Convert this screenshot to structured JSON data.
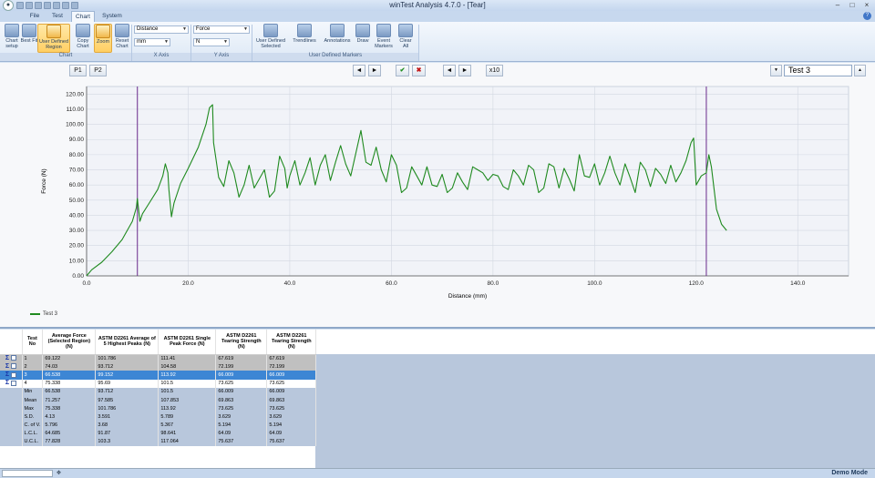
{
  "app": {
    "title": "winTest Analysis 4.7.0 - [Tear]",
    "icon": "app-logo-icon",
    "window_buttons": [
      "–",
      "□",
      "×"
    ]
  },
  "tabs": [
    {
      "label": "File"
    },
    {
      "label": "Test"
    },
    {
      "label": "Chart"
    },
    {
      "label": "System"
    }
  ],
  "active_tab": "Chart",
  "ribbon": {
    "chart_group": {
      "label": "Chart",
      "buttons": [
        "Chart setup",
        "Best Fit",
        "User Defined Region",
        "Copy Chart",
        "Zoom",
        "Reset Chart"
      ]
    },
    "x_axis": {
      "label": "X Axis",
      "quantity": "Distance",
      "unit": "mm"
    },
    "y_axis": {
      "label": "Y Axis",
      "quantity": "Force",
      "unit": "N"
    },
    "markers_group": {
      "label": "User Defined Markers",
      "buttons": [
        "User Defined Selected",
        "Trendlines",
        "Annotations",
        "Draw",
        "Event Markers",
        "Clear All"
      ]
    }
  },
  "toolbar": {
    "p1": "P1",
    "p2": "P2",
    "prev": "◄",
    "next": "►",
    "accept": "✔",
    "reject": "✖",
    "prev2": "◄",
    "next2": "►",
    "x10": "x10",
    "test_select": "Test 3",
    "down": "▼",
    "up": "▲"
  },
  "chart_data": {
    "type": "line",
    "xlabel": "Distance (mm)",
    "ylabel": "Force (N)",
    "xlim": [
      0,
      150
    ],
    "ylim": [
      0,
      125
    ],
    "x_ticks": [
      "0.0",
      "20.0",
      "40.0",
      "60.0",
      "80.0",
      "100.0",
      "120.0",
      "140.0"
    ],
    "y_ticks": [
      "0.00",
      "10.00",
      "20.00",
      "30.00",
      "40.00",
      "50.00",
      "60.00",
      "70.00",
      "80.00",
      "90.00",
      "100.00",
      "110.00",
      "120.00"
    ],
    "region_markers": [
      10,
      122
    ],
    "grid": true,
    "legend": "bottom-left",
    "series": [
      {
        "name": "Test 3",
        "color": "#1f8a1f",
        "points": [
          [
            0,
            0
          ],
          [
            1,
            4
          ],
          [
            3,
            9
          ],
          [
            5,
            16
          ],
          [
            7,
            24
          ],
          [
            8,
            30
          ],
          [
            9,
            36
          ],
          [
            9.8,
            45
          ],
          [
            10,
            51
          ],
          [
            10.5,
            36
          ],
          [
            11,
            41
          ],
          [
            12.5,
            49
          ],
          [
            14,
            57
          ],
          [
            15,
            66
          ],
          [
            15.5,
            74
          ],
          [
            16,
            68
          ],
          [
            16.2,
            57
          ],
          [
            16.7,
            39
          ],
          [
            17.2,
            48
          ],
          [
            18.5,
            61
          ],
          [
            20,
            71
          ],
          [
            22,
            85
          ],
          [
            23.5,
            100
          ],
          [
            24.2,
            111
          ],
          [
            24.8,
            113
          ],
          [
            25,
            88
          ],
          [
            26,
            65
          ],
          [
            27,
            59
          ],
          [
            28,
            76
          ],
          [
            29,
            68
          ],
          [
            30,
            52
          ],
          [
            31,
            60
          ],
          [
            32,
            73
          ],
          [
            33,
            58
          ],
          [
            34,
            64
          ],
          [
            35,
            70
          ],
          [
            36,
            52
          ],
          [
            37,
            56
          ],
          [
            38,
            79
          ],
          [
            39,
            71
          ],
          [
            39.5,
            58
          ],
          [
            40,
            66
          ],
          [
            41,
            76
          ],
          [
            42,
            60
          ],
          [
            43,
            68
          ],
          [
            44,
            78
          ],
          [
            45,
            60
          ],
          [
            46,
            73
          ],
          [
            47,
            80
          ],
          [
            48,
            63
          ],
          [
            49,
            75
          ],
          [
            50,
            86
          ],
          [
            51,
            74
          ],
          [
            52,
            66
          ],
          [
            53,
            81
          ],
          [
            54,
            96
          ],
          [
            55,
            75
          ],
          [
            56,
            73
          ],
          [
            57,
            85
          ],
          [
            58,
            70
          ],
          [
            59,
            62
          ],
          [
            60,
            80
          ],
          [
            61,
            73
          ],
          [
            62,
            55
          ],
          [
            63,
            58
          ],
          [
            64,
            72
          ],
          [
            65,
            66
          ],
          [
            66,
            60
          ],
          [
            67,
            72
          ],
          [
            68,
            60
          ],
          [
            69,
            59
          ],
          [
            70,
            67
          ],
          [
            71,
            55
          ],
          [
            72,
            58
          ],
          [
            73,
            68
          ],
          [
            74,
            62
          ],
          [
            75,
            57
          ],
          [
            76,
            72
          ],
          [
            77,
            70
          ],
          [
            78,
            68
          ],
          [
            79,
            63
          ],
          [
            80,
            67
          ],
          [
            81,
            66
          ],
          [
            82,
            59
          ],
          [
            83,
            57
          ],
          [
            84,
            70
          ],
          [
            85,
            66
          ],
          [
            86,
            60
          ],
          [
            87,
            73
          ],
          [
            88,
            70
          ],
          [
            89,
            55
          ],
          [
            90,
            58
          ],
          [
            91,
            74
          ],
          [
            92,
            72
          ],
          [
            93,
            58
          ],
          [
            94,
            71
          ],
          [
            95,
            64
          ],
          [
            96,
            56
          ],
          [
            97,
            80
          ],
          [
            98,
            66
          ],
          [
            99,
            65
          ],
          [
            100,
            74
          ],
          [
            101,
            60
          ],
          [
            102,
            68
          ],
          [
            103,
            79
          ],
          [
            104,
            68
          ],
          [
            105,
            60
          ],
          [
            106,
            74
          ],
          [
            107,
            65
          ],
          [
            108,
            55
          ],
          [
            109,
            75
          ],
          [
            110,
            70
          ],
          [
            111,
            59
          ],
          [
            112,
            71
          ],
          [
            113,
            67
          ],
          [
            114,
            61
          ],
          [
            115,
            73
          ],
          [
            116,
            62
          ],
          [
            117,
            68
          ],
          [
            118,
            76
          ],
          [
            119,
            88
          ],
          [
            119.5,
            91
          ],
          [
            120,
            60
          ],
          [
            121,
            66
          ],
          [
            122,
            68
          ],
          [
            122.5,
            80
          ],
          [
            123,
            72
          ],
          [
            123.5,
            58
          ],
          [
            124,
            44
          ],
          [
            125,
            34
          ],
          [
            126,
            30
          ]
        ]
      }
    ]
  },
  "table": {
    "headers": [
      "Test No",
      "Average Force (Selected Region) (N)",
      "ASTM D2261 Average of 5 Highest Peaks (N)",
      "ASTM D2261 Single Peak Force (N)",
      "ASTM D2261 Tearing Strength (N)",
      "ASTM D2261 Tearing Strength (N)"
    ],
    "rows": [
      {
        "no": "1",
        "v": [
          "69.122",
          "101.786",
          "111.41",
          "67.619",
          "67.619"
        ],
        "style": "g"
      },
      {
        "no": "2",
        "v": [
          "74.03",
          "93.712",
          "104.58",
          "72.199",
          "72.199"
        ],
        "style": "g"
      },
      {
        "no": "3",
        "v": [
          "66.538",
          "99.152",
          "113.92",
          "66.009",
          "66.009"
        ],
        "style": "sel"
      },
      {
        "no": "4",
        "v": [
          "75.338",
          "95.69",
          "101.5",
          "73.625",
          "73.625"
        ],
        "style": "w"
      }
    ],
    "stats": [
      {
        "label": "Min",
        "v": [
          "66.538",
          "93.712",
          "101.5",
          "66.009",
          "66.009"
        ]
      },
      {
        "label": "Mean",
        "v": [
          "71.257",
          "97.585",
          "107.853",
          "69.863",
          "69.863"
        ]
      },
      {
        "label": "Max",
        "v": [
          "75.338",
          "101.786",
          "113.92",
          "73.625",
          "73.625"
        ]
      },
      {
        "label": "S.D.",
        "v": [
          "4.13",
          "3.591",
          "5.789",
          "3.629",
          "3.629"
        ]
      },
      {
        "label": "C. of V.",
        "v": [
          "5.796",
          "3.68",
          "5.367",
          "5.194",
          "5.194"
        ]
      },
      {
        "label": "L.C.L.",
        "v": [
          "64.685",
          "91.87",
          "98.641",
          "64.09",
          "64.09"
        ]
      },
      {
        "label": "U.C.L.",
        "v": [
          "77.828",
          "103.3",
          "117.064",
          "75.637",
          "75.637"
        ]
      }
    ]
  },
  "status": {
    "mode": "Demo Mode"
  }
}
